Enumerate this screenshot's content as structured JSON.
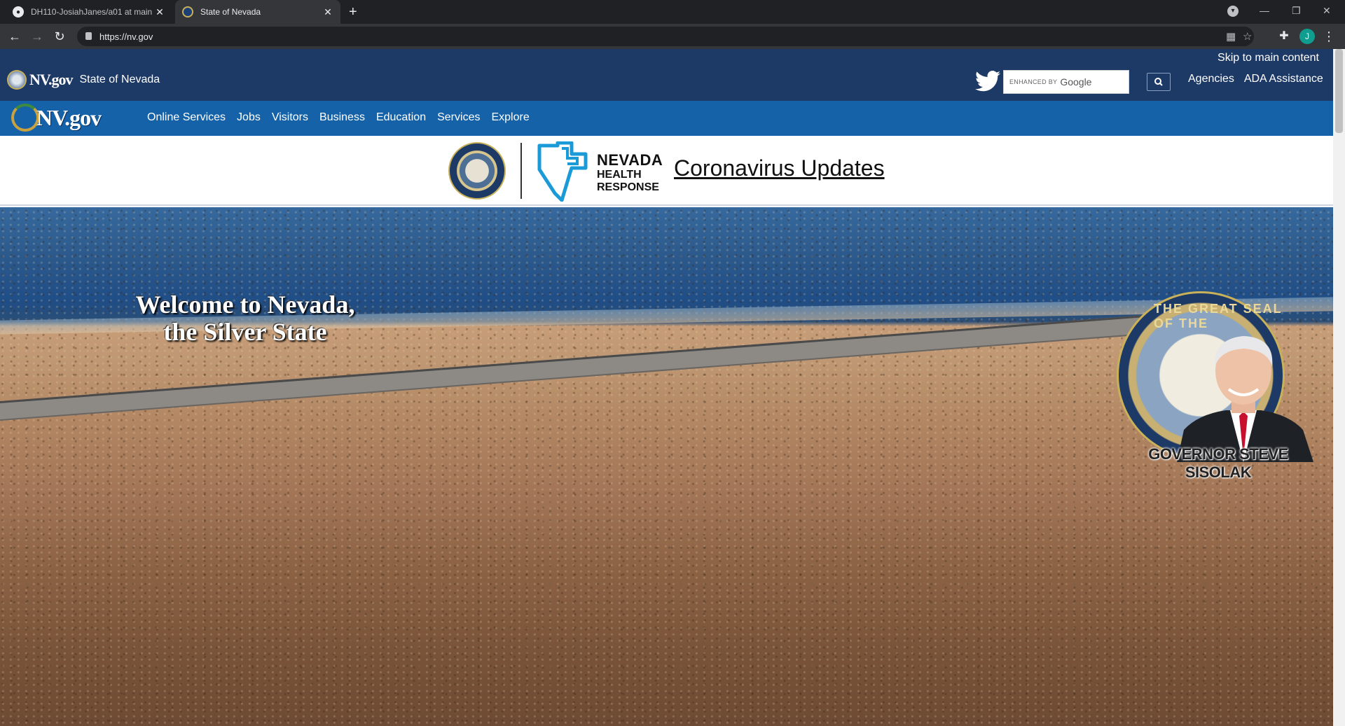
{
  "browser": {
    "tabs": [
      {
        "title": "DH110-JosiahJanes/a01 at main",
        "active": false
      },
      {
        "title": "State of Nevada",
        "active": true
      }
    ],
    "new_tab": "+",
    "url": "https://nv.gov",
    "profile_initial": "J"
  },
  "header": {
    "brand_logo": "NV.gov",
    "state_name": "State of Nevada",
    "skip_link": "Skip to main content",
    "search": {
      "enhanced_by": "ENHANCED BY",
      "google": "Google"
    },
    "links": [
      "Agencies",
      "ADA Assistance"
    ]
  },
  "nav": {
    "logo": "NV.gov",
    "items": [
      "Online Services",
      "Jobs",
      "Visitors",
      "Business",
      "Education",
      "Services",
      "Explore"
    ]
  },
  "banner": {
    "nhr_line1": "NEVADA",
    "nhr_line2": "HEALTH",
    "nhr_line3": "RESPONSE",
    "link": "Coronavirus Updates"
  },
  "hero": {
    "welcome_line1": "Welcome to Nevada,",
    "welcome_line2": "the Silver State",
    "seal_text": "THE GREAT SEAL OF THE",
    "governor": "GOVERNOR STEVE SISOLAK"
  },
  "colors": {
    "topbar": "#1d3966",
    "navbar": "#1562a8",
    "chrome_dark": "#202124",
    "chrome_toolbar": "#35363a"
  }
}
